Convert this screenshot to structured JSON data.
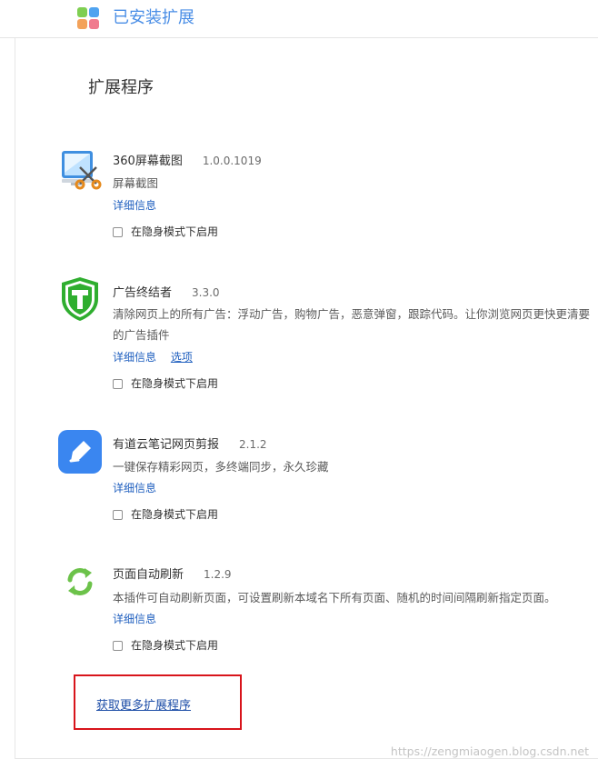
{
  "header": {
    "title": "已安装扩展"
  },
  "section": {
    "title": "扩展程序"
  },
  "extensions": [
    {
      "name": "360屏幕截图",
      "version": "1.0.0.1019",
      "description": "屏幕截图",
      "details_label": "详细信息",
      "incognito_label": "在隐身模式下启用",
      "icon": "screenshot-scissors-icon"
    },
    {
      "name": "广告终结者",
      "version": "3.3.0",
      "description": "清除网页上的所有广告：浮动广告，购物广告，恶意弹窗，跟踪代码。让你浏览网页更快更清要的广告插件",
      "details_label": "详细信息",
      "options_label": "选项",
      "incognito_label": "在隐身模式下启用",
      "icon": "shield-t-icon"
    },
    {
      "name": "有道云笔记网页剪报",
      "version": "2.1.2",
      "description": "一键保存精彩网页，多终端同步，永久珍藏",
      "details_label": "详细信息",
      "incognito_label": "在隐身模式下启用",
      "icon": "note-pen-icon"
    },
    {
      "name": "页面自动刷新",
      "version": "1.2.9",
      "description": "本插件可自动刷新页面，可设置刷新本域名下所有页面、随机的时间间隔刷新指定页面。",
      "details_label": "详细信息",
      "incognito_label": "在隐身模式下启用",
      "icon": "refresh-arrows-icon"
    }
  ],
  "footer": {
    "more_label": "获取更多扩展程序",
    "watermark": "https://zengmiaogen.blog.csdn.net"
  },
  "colors": {
    "title_blue": "#4a8ee6",
    "link_blue": "#1f5fbf",
    "highlight_red": "#d8141b",
    "shield_green": "#2fae2f",
    "note_blue": "#3a86f0",
    "refresh_green": "#6cc24a"
  }
}
